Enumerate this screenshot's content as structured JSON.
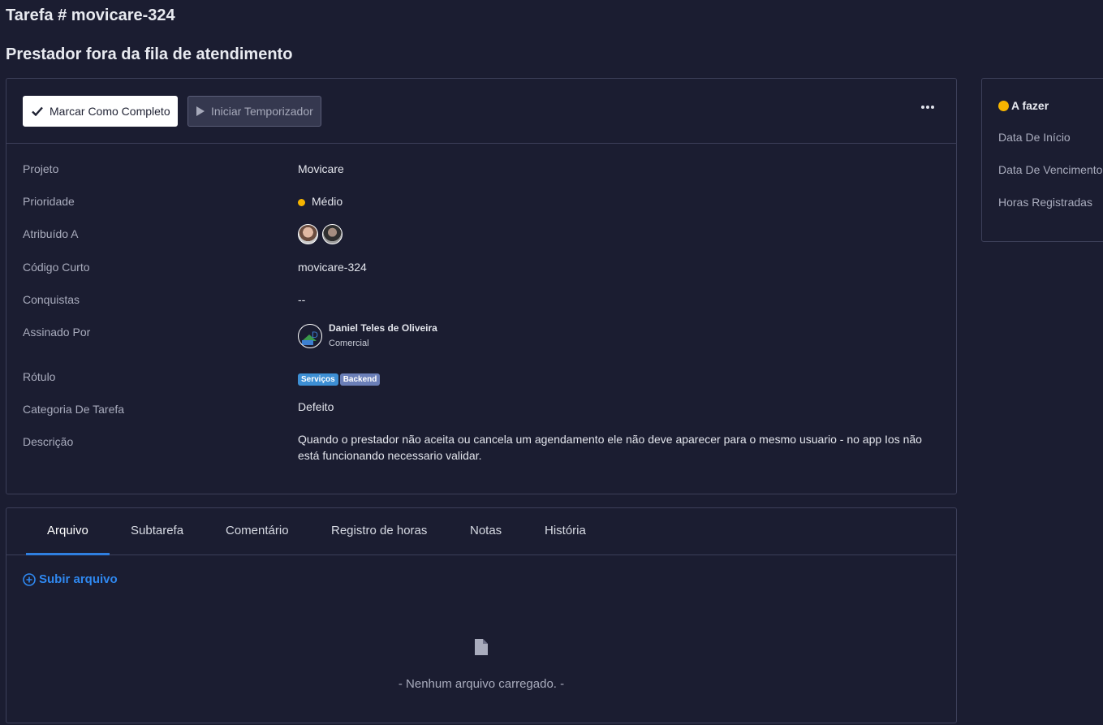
{
  "header": {
    "heading": "Tarefa # movicare-324",
    "title": "Prestador fora da fila de atendimento"
  },
  "toolbar": {
    "complete_label": "Marcar Como Completo",
    "timer_label": "Iniciar Temporizador"
  },
  "details": {
    "project_label": "Projeto",
    "project_value": "Movicare",
    "priority_label": "Prioridade",
    "priority_value": "Médio",
    "priority_color": "#f5b400",
    "assigned_label": "Atribuído A",
    "short_code_label": "Código Curto",
    "short_code_value": "movicare-324",
    "milestones_label": "Conquistas",
    "milestones_value": "--",
    "signed_label": "Assinado Por",
    "signer_name": "Daniel Teles de Oliveira",
    "signer_dept": "Comercial",
    "label_label": "Rótulo",
    "tags": [
      {
        "text": "Serviços",
        "color": "#3d8fd4"
      },
      {
        "text": "Backend",
        "color": "#6b7fb8"
      }
    ],
    "category_label": "Categoria De Tarefa",
    "category_value": "Defeito",
    "description_label": "Descrição",
    "description_value": "Quando o prestador não aceita ou cancela um agendamento ele não deve aparecer para o mesmo usuario - no app Ios não está funcionando necessario validar."
  },
  "side": {
    "status": "A fazer",
    "status_color": "#f5b400",
    "start_label": "Data De Início",
    "due_label": "Data De Vencimento",
    "hours_label": "Horas Registradas"
  },
  "tabs": [
    {
      "label": "Arquivo",
      "active": true
    },
    {
      "label": "Subtarefa"
    },
    {
      "label": "Comentário"
    },
    {
      "label": "Registro de horas"
    },
    {
      "label": "Notas"
    },
    {
      "label": "História"
    }
  ],
  "files": {
    "upload_label": "Subir arquivo",
    "empty_text": "- Nenhum arquivo carregado. -"
  }
}
